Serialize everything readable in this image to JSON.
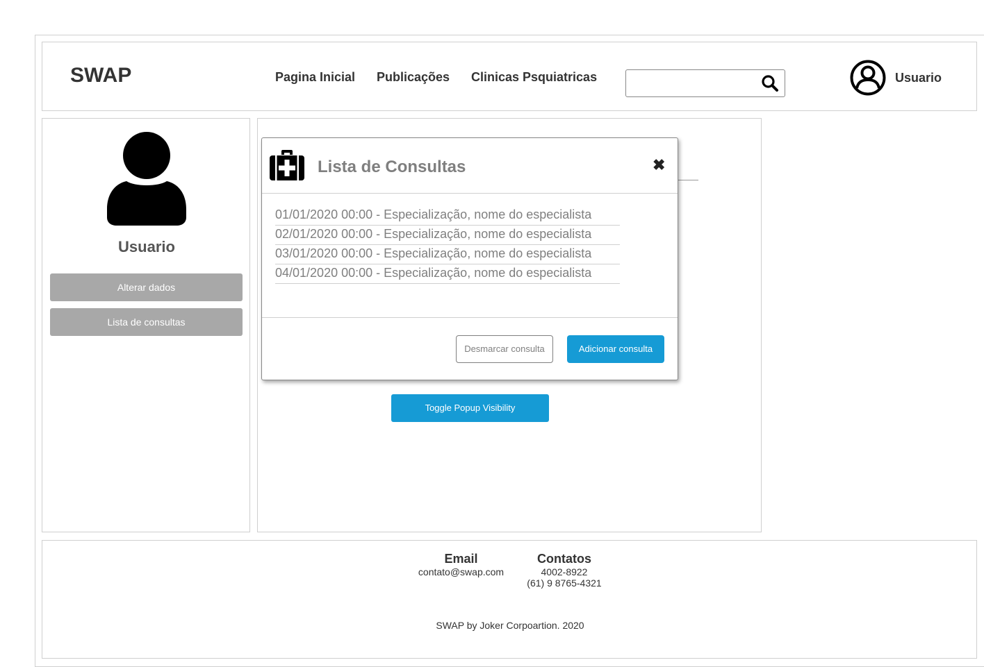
{
  "header": {
    "logo": "SWAP",
    "nav": [
      "Pagina Inicial",
      "Publicações",
      "Clinicas Psquiatricas"
    ],
    "search_placeholder": "",
    "user_label": "Usuario"
  },
  "sidebar": {
    "user_name": "Usuario",
    "buttons": [
      "Alterar dados",
      "Lista de consultas"
    ]
  },
  "main": {
    "toggle_button": "Toggle Popup Visibility"
  },
  "modal": {
    "title": "Lista de Consultas",
    "close_symbol": "✖",
    "consultations": [
      "01/01/2020 00:00 - Especialização, nome do especialista",
      "02/01/2020 00:00 - Especialização, nome do especialista",
      "03/01/2020 00:00 - Especialização, nome do especialista",
      "04/01/2020 00:00 - Especialização, nome do especialista"
    ],
    "cancel_button": "Desmarcar consulta",
    "add_button": "Adicionar consulta"
  },
  "footer": {
    "email_heading": "Email",
    "email": "contato@swap.com",
    "contacts_heading": "Contatos",
    "phone1": "4002-8922",
    "phone2": "(61) 9 8765-4321",
    "copyright": "SWAP by Joker Corpoartion. 2020"
  },
  "colors": {
    "primary": "#169bd5",
    "sidebar_button": "#a8a8a8",
    "muted_text": "#7f7f7f"
  },
  "icons": [
    "search-icon",
    "user-circle-icon",
    "user-icon",
    "medical-kit-icon",
    "close-icon"
  ]
}
